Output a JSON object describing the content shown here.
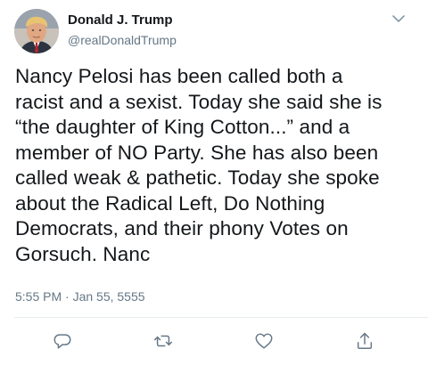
{
  "tweet": {
    "author": {
      "display_name": "Donald J. Trump",
      "handle": "@realDonaldTrump",
      "avatar_icon": "profile-photo"
    },
    "lines": [
      "Nancy Pelosi has been called both a",
      "racist and a sexist. Today she said she is",
      "“the daughter of King Cotton...” and a",
      "member of NO Party. She has also been",
      "called weak & pathetic. Today she spoke",
      "about the Radical Left, Do Nothing",
      "Democrats, and their phony Votes on",
      "Gorsuch. Nanc"
    ],
    "timestamp": "5:55 PM · Jan 55, 5555"
  },
  "actions": {
    "icons": [
      "reply-icon",
      "retweet-icon",
      "like-icon",
      "share-icon"
    ],
    "icon_color": "#657786"
  },
  "colors": {
    "text_primary": "#14171a",
    "text_secondary": "#657786",
    "divider": "#e6ecf0"
  }
}
